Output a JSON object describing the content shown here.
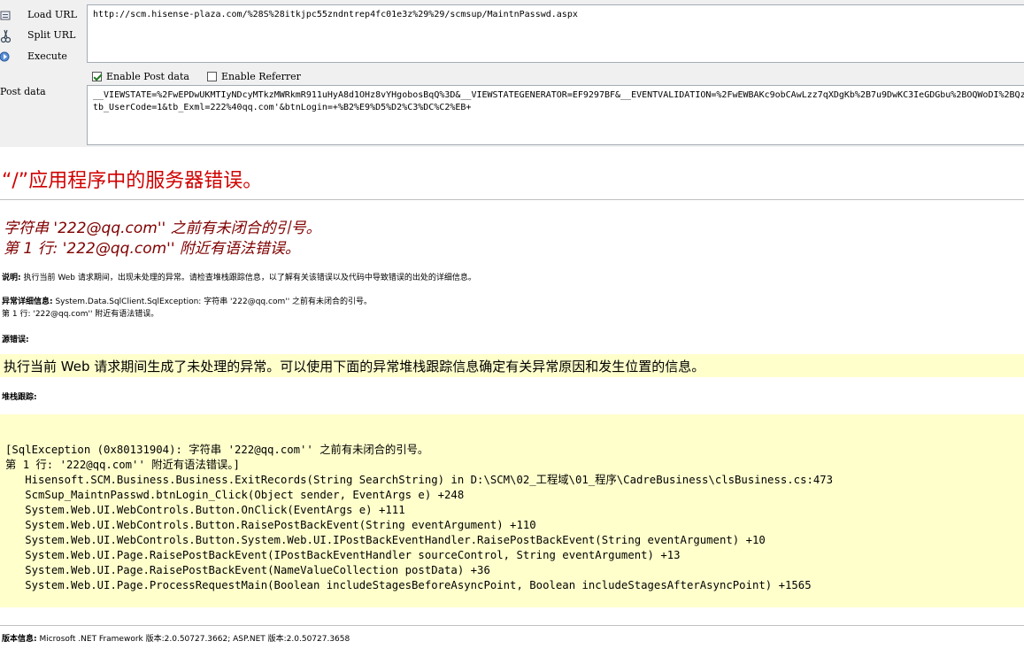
{
  "toolbar": {
    "load_url": "Load URL",
    "split_url": "Split URL",
    "execute": "Execute",
    "url_value": "http://scm.hisense-plaza.com/%28S%28itkjpc55zndntrep4fc01e3z%29%29/scmsup/MaintnPasswd.aspx",
    "enable_post": "Enable Post data",
    "enable_referrer": "Enable Referrer",
    "post_label": "Post data",
    "post_line1": "__VIEWSTATE=%2FwEPDwUKMTIyNDcyMTkzMWRkmR911uHyA8d1OHz8vYHgobosBqQ%3D&__VIEWSTATEGENERATOR=EF9297BF&__EVENTVALIDATION=%2FwEWBAKc9obCAwLzz7qXDgKb%2B7u9DwKC3IeGDGbu%2BOQWoDI%2BQz",
    "post_line2": "tb_UserCode=1&tb_Exml=222%40qq.com'&btnLogin=+%B2%E9%D5%D2%C3%DC%C2%EB+"
  },
  "page": {
    "title": "“/”应用程序中的服务器错误。",
    "error_line1": "字符串 '222@qq.com'' 之前有未闭合的引号。",
    "error_line2": "第 1 行: '222@qq.com'' 附近有语法错误。",
    "desc_label": "说明:",
    "desc_text": " 执行当前 Web 请求期间，出现未处理的异常。请检查堆栈跟踪信息，以了解有关该错误以及代码中导致错误的出处的详细信息。",
    "exc_label": "异常详细信息:",
    "exc_text": " System.Data.SqlClient.SqlException: 字符串 '222@qq.com'' 之前有未闭合的引号。",
    "exc_text2": "第 1 行: '222@qq.com'' 附近有语法错误。",
    "src_label": "源错误:",
    "src_text": "执行当前 Web 请求期间生成了未处理的异常。可以使用下面的异常堆栈跟踪信息确定有关异常原因和发生位置的信息。",
    "stack_label": "堆栈跟踪:",
    "stack_trace": "[SqlException (0x80131904): 字符串 '222@qq.com'' 之前有未闭合的引号。\n第 1 行: '222@qq.com'' 附近有语法错误。]\n   Hisensoft.SCM.Business.Business.ExitRecords(String SearchString) in D:\\SCM\\02_工程域\\01_程序\\CadreBusiness\\clsBusiness.cs:473\n   ScmSup_MaintnPasswd.btnLogin_Click(Object sender, EventArgs e) +248\n   System.Web.UI.WebControls.Button.OnClick(EventArgs e) +111\n   System.Web.UI.WebControls.Button.RaisePostBackEvent(String eventArgument) +110\n   System.Web.UI.WebControls.Button.System.Web.UI.IPostBackEventHandler.RaisePostBackEvent(String eventArgument) +10\n   System.Web.UI.Page.RaisePostBackEvent(IPostBackEventHandler sourceControl, String eventArgument) +13\n   System.Web.UI.Page.RaisePostBackEvent(NameValueCollection postData) +36\n   System.Web.UI.Page.ProcessRequestMain(Boolean includeStagesBeforeAsyncPoint, Boolean includeStagesAfterAsyncPoint) +1565",
    "version_label": "版本信息:",
    "version_text": " Microsoft .NET Framework 版本:2.0.50727.3662; ASP.NET 版本:2.0.50727.3658"
  },
  "colors": {
    "title": "#d00000",
    "subtitle": "#800000",
    "highlight": "#ffffcc",
    "toolbar": "#f0f0f0"
  }
}
